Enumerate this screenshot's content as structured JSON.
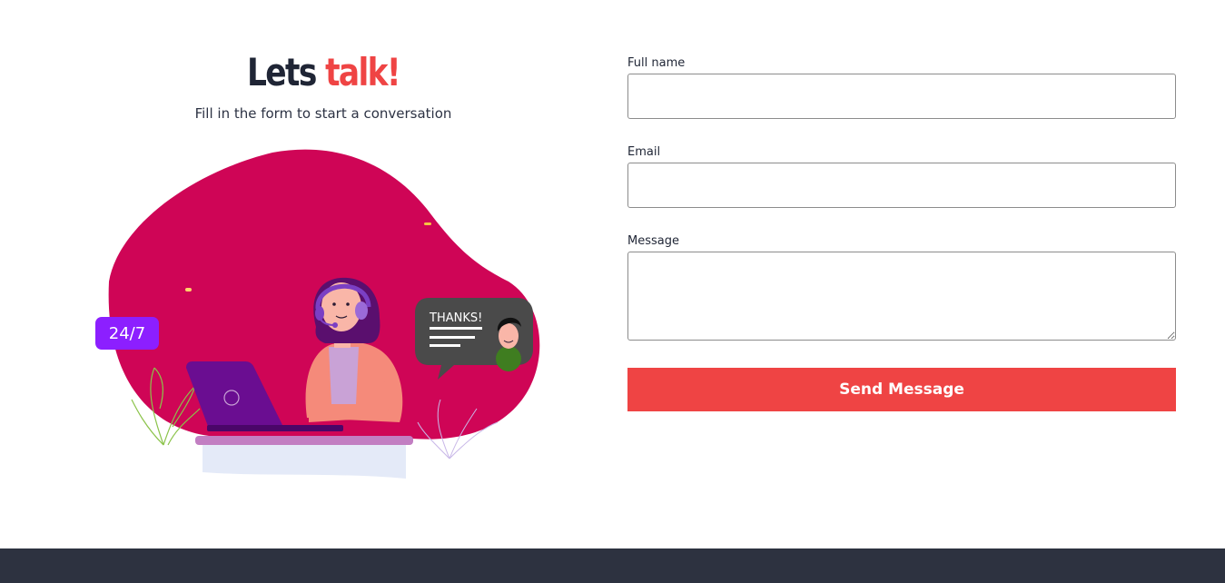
{
  "heading": {
    "part1": "Lets ",
    "part2": "talk!",
    "subtitle": "Fill in the form to start a conversation"
  },
  "illustration": {
    "badge_text": "24/7",
    "bubble_text": "THANKS!"
  },
  "form": {
    "fields": [
      {
        "label": "Full name",
        "value": "",
        "placeholder": ""
      },
      {
        "label": "Email",
        "value": "",
        "placeholder": ""
      },
      {
        "label": "Message",
        "value": "",
        "placeholder": ""
      }
    ],
    "submit_label": "Send Message"
  },
  "colors": {
    "accent": "#ef4444",
    "heading_dark": "#1f2535",
    "blob": "#cf0556",
    "footer": "#2d3240"
  }
}
